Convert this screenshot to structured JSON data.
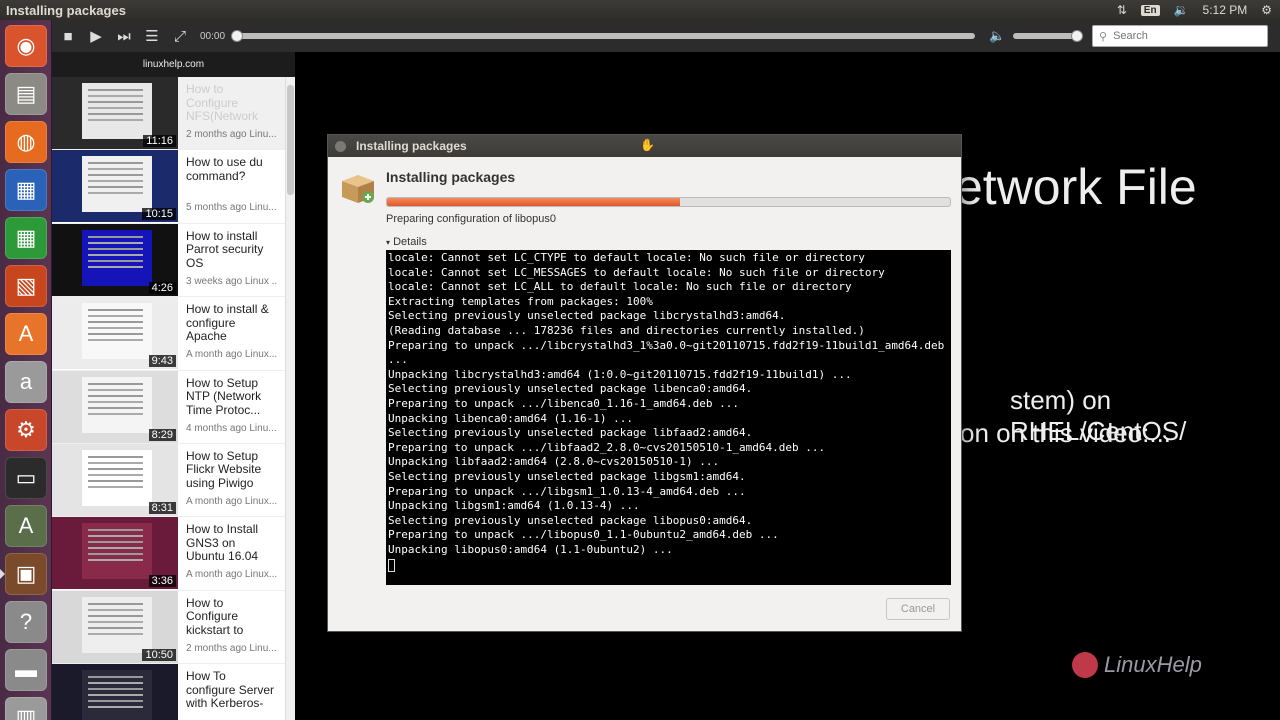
{
  "top_panel": {
    "title": "Installing packages",
    "keyboard_layout": "En",
    "clock": "5:12 PM"
  },
  "launcher": {
    "items": [
      {
        "name": "ubuntu-dash-icon",
        "glyph": "◉",
        "bg": "#d9532c"
      },
      {
        "name": "files-icon",
        "glyph": "▤",
        "bg": "#8c8a85"
      },
      {
        "name": "firefox-icon",
        "glyph": "◍",
        "bg": "#e66a1f"
      },
      {
        "name": "writer-icon",
        "glyph": "▦",
        "bg": "#2a62b8"
      },
      {
        "name": "calc-icon",
        "glyph": "▦",
        "bg": "#2d9a3a"
      },
      {
        "name": "impress-icon",
        "glyph": "▧",
        "bg": "#c8461e"
      },
      {
        "name": "software-center-icon",
        "glyph": "A",
        "bg": "#e8742a"
      },
      {
        "name": "amazon-icon",
        "glyph": "a",
        "bg": "#9a9a9a"
      },
      {
        "name": "settings-icon",
        "glyph": "⚙",
        "bg": "#c8462a"
      },
      {
        "name": "terminal-icon",
        "glyph": "▭",
        "bg": "#2b2b2b"
      },
      {
        "name": "updater-icon",
        "glyph": "A",
        "bg": "#5a6e4a"
      },
      {
        "name": "video-player-icon",
        "glyph": "▣",
        "bg": "#7a4a2a"
      },
      {
        "name": "help-icon",
        "glyph": "?",
        "bg": "#8a8a8a"
      },
      {
        "name": "save-icon",
        "glyph": "▬",
        "bg": "#8a8a8a"
      },
      {
        "name": "trash-icon",
        "glyph": "▥",
        "bg": "#9a9a9a"
      }
    ]
  },
  "player": {
    "time": "00:00",
    "progress": 0,
    "volume": 1.0
  },
  "search": {
    "placeholder": "Search"
  },
  "sidebar": {
    "channel": "linuxhelp.com",
    "videos": [
      {
        "title": "How to Configure NFS(Network File System) in Linux",
        "meta": "2 months ago   Linu...",
        "duration": "11:16",
        "thumb_bg": "#2a2a2a",
        "screen_bg": "#e8e8e8",
        "current": true
      },
      {
        "title": "How to use du command?",
        "meta": "5 months ago   Linu...",
        "duration": "10:15",
        "thumb_bg": "#1a2a6a",
        "screen_bg": "#f0f0f0",
        "current": false
      },
      {
        "title": "How to install Parrot security OS",
        "meta": "3 weeks ago   Linux ...",
        "duration": "4:26",
        "thumb_bg": "#111111",
        "screen_bg": "#1414b8",
        "current": false
      },
      {
        "title": "How to install & configure Apache Subversion (SV...",
        "meta": "A month ago   Linux...",
        "duration": "9:43",
        "thumb_bg": "#ececec",
        "screen_bg": "#f8f8f8",
        "current": false
      },
      {
        "title": "How to Setup NTP (Network Time Protoc...",
        "meta": "4 months ago   Linu...",
        "duration": "8:29",
        "thumb_bg": "#dddddd",
        "screen_bg": "#f4f4f4",
        "current": false
      },
      {
        "title": "How to Setup Flickr Website using Piwigo",
        "meta": "A month ago   Linux...",
        "duration": "8:31",
        "thumb_bg": "#e4e4e4",
        "screen_bg": "#ffffff",
        "current": false
      },
      {
        "title": "How to Install GNS3 on Ubuntu 16.04",
        "meta": "A month ago   Linux...",
        "duration": "3:36",
        "thumb_bg": "#6a1a3a",
        "screen_bg": "#8a2a4a",
        "current": false
      },
      {
        "title": "How to Configure kickstart to automate RHEL...",
        "meta": "2 months ago   Linu...",
        "duration": "10:50",
        "thumb_bg": "#d8d8d8",
        "screen_bg": "#eeeeee",
        "current": false
      },
      {
        "title": "How To configure Server with Kerberos-based...",
        "meta": "",
        "duration": "",
        "thumb_bg": "#1a1a2a",
        "screen_bg": "#2a2a3a",
        "current": false
      }
    ]
  },
  "background_video": {
    "line1": "etwork File",
    "line2": "stem) on RHEL/CentOS/",
    "line3": "on on this video:...",
    "logo": "LinuxHelp"
  },
  "dialog": {
    "title": "Installing packages",
    "heading": "Installing packages",
    "progress": 0.52,
    "status": "Preparing configuration of libopus0",
    "details_label": "Details",
    "terminal_lines": [
      "locale: Cannot set LC_CTYPE to default locale: No such file or directory",
      "locale: Cannot set LC_MESSAGES to default locale: No such file or directory",
      "locale: Cannot set LC_ALL to default locale: No such file or directory",
      "Extracting templates from packages: 100%",
      "Selecting previously unselected package libcrystalhd3:amd64.",
      "(Reading database ... 178236 files and directories currently installed.)",
      "Preparing to unpack .../libcrystalhd3_1%3a0.0~git20110715.fdd2f19-11build1_amd64.deb ...",
      "Unpacking libcrystalhd3:amd64 (1:0.0~git20110715.fdd2f19-11build1) ...",
      "Selecting previously unselected package libenca0:amd64.",
      "Preparing to unpack .../libenca0_1.16-1_amd64.deb ...",
      "Unpacking libenca0:amd64 (1.16-1) ...",
      "Selecting previously unselected package libfaad2:amd64.",
      "Preparing to unpack .../libfaad2_2.8.0~cvs20150510-1_amd64.deb ...",
      "Unpacking libfaad2:amd64 (2.8.0~cvs20150510-1) ...",
      "Selecting previously unselected package libgsm1:amd64.",
      "Preparing to unpack .../libgsm1_1.0.13-4_amd64.deb ...",
      "Unpacking libgsm1:amd64 (1.0.13-4) ...",
      "Selecting previously unselected package libopus0:amd64.",
      "Preparing to unpack .../libopus0_1.1-0ubuntu2_amd64.deb ...",
      "Unpacking libopus0:amd64 (1.1-0ubuntu2) ..."
    ],
    "cancel_label": "Cancel"
  }
}
